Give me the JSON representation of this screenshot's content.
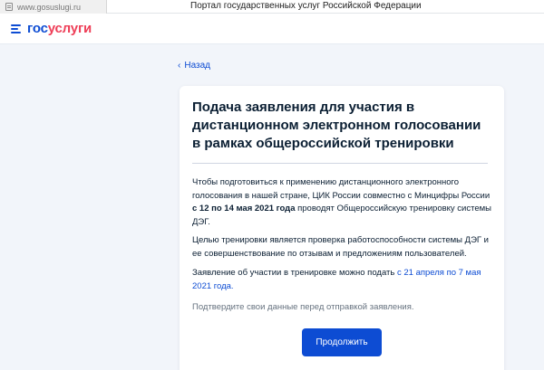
{
  "browser": {
    "url": "www.gosuslugi.ru"
  },
  "portal": {
    "title": "Портал государственных услуг Российской Федерации"
  },
  "header": {
    "logo_part1": "гос",
    "logo_part2": "услуги",
    "menu_icon": "hamburger-menu-icon"
  },
  "nav": {
    "back_label": "Назад",
    "back_icon": "chevron-left-icon"
  },
  "card": {
    "title": "Подача заявления для участия в дистанционном электронном голосовании в рамках общероссийской тренировки",
    "para1": {
      "before": "Чтобы подготовиться к применению дистанционного электронного голосования в нашей стране, ЦИК России совместно с Минцифры России ",
      "bold": "с 12 по 14 мая 2021 года",
      "after": " проводят Общероссийскую тренировку системы ДЭГ."
    },
    "para2": "Целью тренировки является проверка работоспособности системы ДЭГ и ее совершенствование по отзывам и предложениям пользователей.",
    "para3": {
      "before": "Заявление об участии в тренировке можно подать ",
      "highlight": "с 21 апреля по 7 мая 2021 года."
    },
    "para4": "Подтвердите свои данные перед отправкой заявления.",
    "continue_label": "Продолжить"
  },
  "colors": {
    "brand_blue": "#0d4cd3",
    "brand_red": "#ee3f58",
    "background": "#f2f5fa",
    "text": "#0b1f33",
    "muted_text": "#66727f"
  }
}
